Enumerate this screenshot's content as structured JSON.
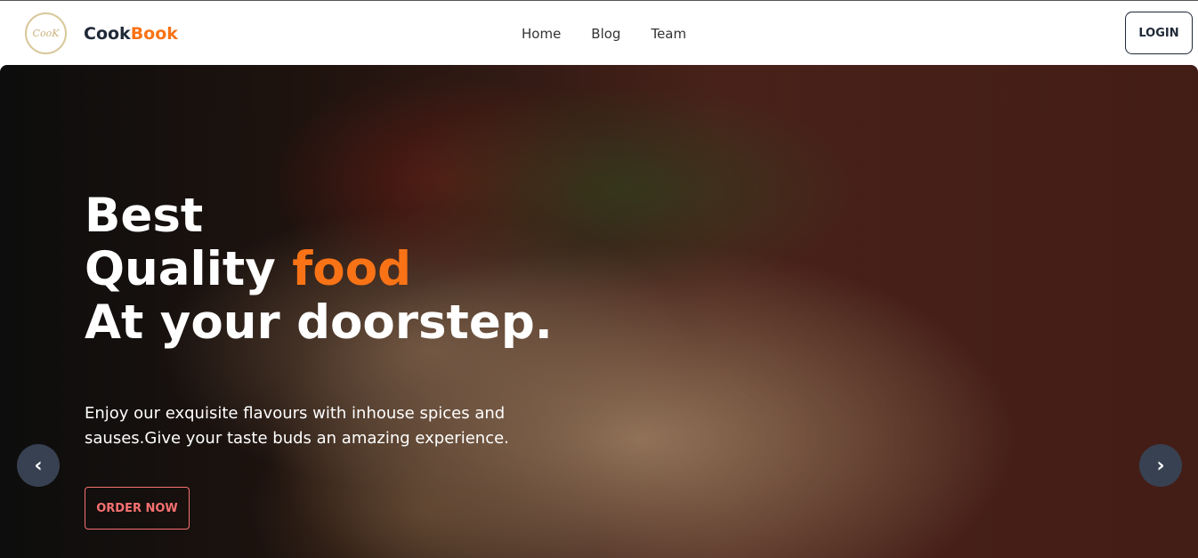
{
  "brand": {
    "logo_text": "CooK",
    "name_a": "Cook",
    "name_b": "Book"
  },
  "nav": {
    "links": [
      "Home",
      "Blog",
      "Team"
    ],
    "login": "LOGIN"
  },
  "hero": {
    "line1": "Best",
    "line2a": "Quality ",
    "line2b": "food",
    "line3": "At your doorstep.",
    "description": "Enjoy our exquisite flavours with inhouse spices and sauses.Give your taste buds an amazing experience.",
    "cta": "ORDER NOW",
    "prev": "‹",
    "next": "›"
  },
  "colors": {
    "accent": "#f97316"
  }
}
